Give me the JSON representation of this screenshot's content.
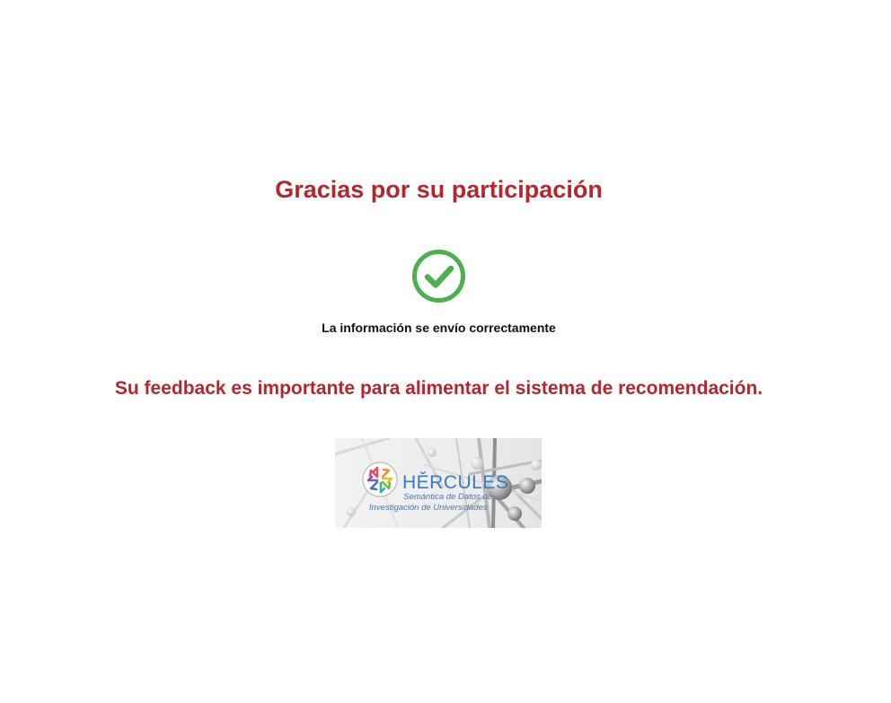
{
  "title": "Gracias por su participación",
  "status": {
    "icon": "check-circle-icon",
    "message": "La información se envío correctamente"
  },
  "feedback": "Su feedback es importante para alimentar el sistema de recomendación.",
  "logo": {
    "name": "HĚRCULES",
    "tagline_line1": "Semántica de Datos de",
    "tagline_line2": "Investigación de Universidades"
  },
  "colors": {
    "accent": "#b5272e",
    "success": "#4caf50",
    "text": "#111111",
    "logo_blue": "#3b79c3"
  }
}
